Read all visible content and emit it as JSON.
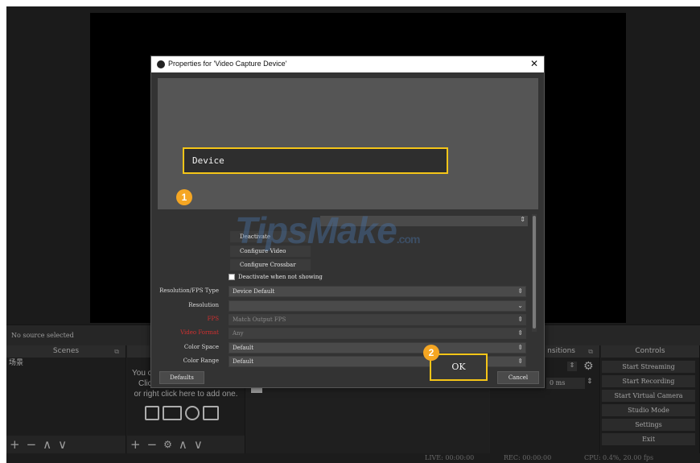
{
  "status": {
    "no_source": "No source selected",
    "live": "LIVE: 00:00:00",
    "rec": "REC: 00:00:00",
    "cpu": "CPU: 0.4%, 20.00 fps"
  },
  "docks": {
    "scenes_title": "Scenes",
    "scene_item": "场景",
    "sources_hint_1": "You c",
    "sources_hint_2": "Clic",
    "sources_hint_3": "or right click here to add one.",
    "transitions_title": "nsitions",
    "transition_ms": "0 ms",
    "controls_title": "Controls"
  },
  "controls": {
    "start_streaming": "Start Streaming",
    "start_recording": "Start Recording",
    "start_virtual_camera": "Start Virtual Camera",
    "studio_mode": "Studio Mode",
    "settings": "Settings",
    "exit": "Exit"
  },
  "dialog": {
    "title": "Properties for 'Video Capture Device'",
    "device_label": "Device",
    "deactivate": "Deactivate",
    "configure_video": "Configure Video",
    "configure_crossbar": "Configure Crossbar",
    "deactivate_when_not_showing": "Deactivate when not showing",
    "resolution_fps_type_label": "Resolution/FPS Type",
    "resolution_fps_type_value": "Device Default",
    "resolution_label": "Resolution",
    "resolution_value": "",
    "fps_label": "FPS",
    "fps_value": "Match Output FPS",
    "video_format_label": "Video Format",
    "video_format_value": "Any",
    "color_space_label": "Color Space",
    "color_space_value": "Default",
    "color_range_label": "Color Range",
    "color_range_value": "Default",
    "defaults_button": "Defaults",
    "ok_button": "OK",
    "cancel_button": "Cancel"
  },
  "annotations": {
    "step1": "1",
    "step2": "2"
  },
  "watermark": {
    "text": "TipsMake",
    "suffix": ".com"
  },
  "colors": {
    "highlight": "#f5c518",
    "badge": "#f5a623",
    "required_label": "#d23030"
  }
}
